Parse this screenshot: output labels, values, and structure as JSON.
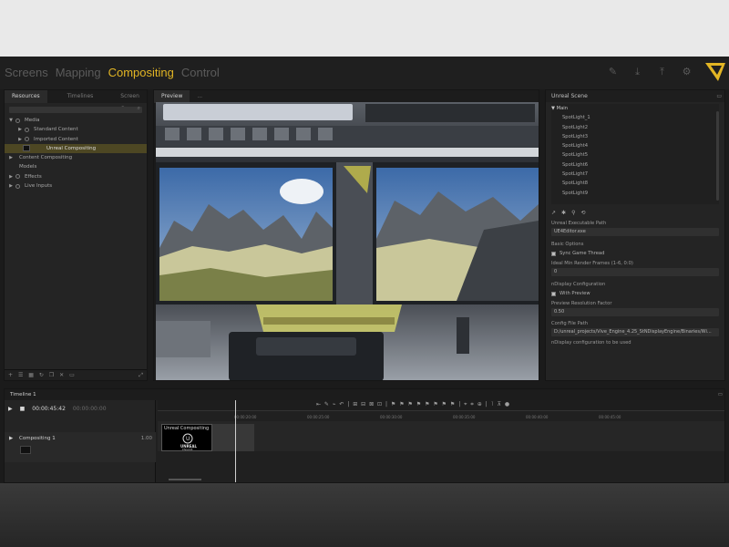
{
  "app": {
    "modes": [
      {
        "label": "Screens",
        "active": false
      },
      {
        "label": "Mapping",
        "active": false
      },
      {
        "label": "Compositing",
        "active": true
      },
      {
        "label": "Control",
        "active": false
      }
    ],
    "accent": "#e2b524"
  },
  "left_panel": {
    "tabs": [
      "Resources",
      "Timelines",
      "Screen Groups"
    ],
    "tree": [
      {
        "label": "Media",
        "level": 0,
        "expanded": true
      },
      {
        "label": "Standard Content",
        "level": 1,
        "expanded": false
      },
      {
        "label": "Imported Content",
        "level": 1,
        "expanded": false
      },
      {
        "label": "Unreal Compositing",
        "level": 2,
        "selected": true
      },
      {
        "label": "Content Compositing",
        "level": 0,
        "expanded": false
      },
      {
        "label": "Models",
        "level": 0,
        "expanded": false
      },
      {
        "label": "Effects",
        "level": 0,
        "expanded": false
      },
      {
        "label": "Live Inputs",
        "level": 0,
        "expanded": false
      }
    ]
  },
  "center_panel": {
    "tabs": [
      "Preview",
      "..."
    ]
  },
  "right_panel": {
    "title": "Unreal Scene",
    "root": "Main",
    "items": [
      "SpotLight_1",
      "SpotLight2",
      "SpotLight3",
      "SpotLight4",
      "SpotLight5",
      "SpotLight6",
      "SpotLight7",
      "SpotLight8",
      "SpotLight9",
      "SpotLight10"
    ],
    "executable_label": "Unreal Executable Path",
    "executable_value": "UE4Editor.exe",
    "basic_options": "Basic Options",
    "sync_game_thread": "Sync Game Thread",
    "min_render_label": "Ideal Min Render Frames (1-6, 0:0)",
    "min_render_value": "0",
    "display_config": "nDisplay Configuration",
    "with_preview": "With Preview",
    "preview_resolution_label": "Preview Resolution Factor",
    "preview_resolution_value": "0.50",
    "config_path_label": "Config File Path",
    "config_path_value": "D:/unreal_projects/Vive_Engine_4.25_StNDisplayEngine/Binaries/Wi...",
    "footer": "nDisplay configuration to be used"
  },
  "timeline": {
    "title": "Timeline 1",
    "timecode": "00:00:45:42",
    "timecode_total": "00:00:00:00",
    "track_name": "Compositing 1",
    "track_value": "1.00",
    "clip_title": "Unreal Compositing",
    "clip_logo_line1": "UNREAL",
    "clip_logo_line2": "ENGINE",
    "ticks": [
      "00:00:20:00",
      "00:00:25:00",
      "00:00:30:00",
      "00:00:35:00",
      "00:00:40:00",
      "00:00:45:00"
    ]
  }
}
